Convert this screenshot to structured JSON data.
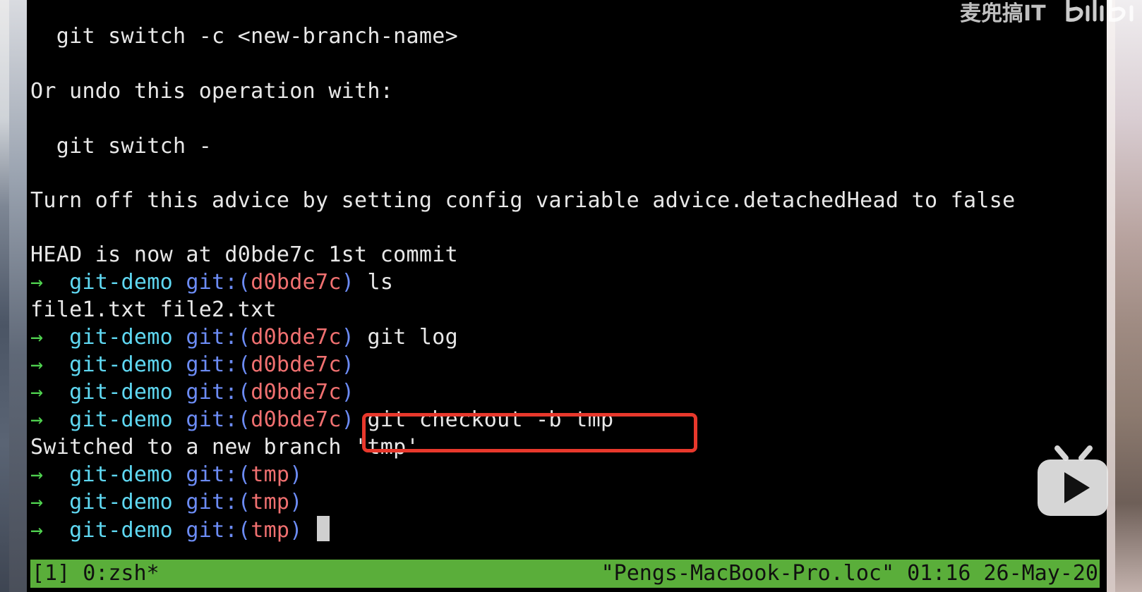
{
  "terminal": {
    "lines": [
      {
        "text": "  git switch -c <new-branch-name>"
      },
      {
        "text": "Or undo this operation with:"
      },
      {
        "text": "  git switch -"
      },
      {
        "text": "Turn off this advice by setting config variable advice.detachedHead to false"
      },
      {
        "text": "HEAD is now at d0bde7c 1st commit"
      },
      {
        "text": "file1.txt file2.txt"
      },
      {
        "text": "Switched to a new branch 'tmp'"
      }
    ],
    "prompts": [
      {
        "arrow": "→",
        "dir": "git-demo",
        "git": "git:(",
        "branch": "d0bde7c",
        "close": ")",
        "cmd": " ls"
      },
      {
        "arrow": "→",
        "dir": "git-demo",
        "git": "git:(",
        "branch": "d0bde7c",
        "close": ")",
        "cmd": " git log"
      },
      {
        "arrow": "→",
        "dir": "git-demo",
        "git": "git:(",
        "branch": "d0bde7c",
        "close": ")",
        "cmd": ""
      },
      {
        "arrow": "→",
        "dir": "git-demo",
        "git": "git:(",
        "branch": "d0bde7c",
        "close": ")",
        "cmd": ""
      },
      {
        "arrow": "→",
        "dir": "git-demo",
        "git": "git:(",
        "branch": "d0bde7c",
        "close": ")",
        "cmd": " git checkout -b tmp"
      },
      {
        "arrow": "→",
        "dir": "git-demo",
        "git": "git:(",
        "branch": "tmp",
        "close": ")",
        "cmd": ""
      },
      {
        "arrow": "→",
        "dir": "git-demo",
        "git": "git:(",
        "branch": "tmp",
        "close": ")",
        "cmd": ""
      },
      {
        "arrow": "→",
        "dir": "git-demo",
        "git": "git:(",
        "branch": "tmp",
        "close": ")",
        "cmd": " "
      }
    ]
  },
  "status_bar": {
    "left": "[1] 0:zsh*",
    "right": "\"Pengs-MacBook-Pro.loc\" 01:16 26-May-20"
  },
  "watermark": {
    "text": "麦兜搞IT",
    "logo": "bilibili"
  },
  "colors": {
    "background": "#000000",
    "text": "#e8e8e8",
    "arrow": "#4fd14f",
    "dir": "#5fd8f2",
    "git": "#6c8cf5",
    "branch": "#f07070",
    "status_bar": "#5aae3a",
    "highlight": "#e8382c"
  },
  "icons": {
    "play_badge": "bilibili-tv-play-icon",
    "logo": "bilibili-logo-icon"
  }
}
